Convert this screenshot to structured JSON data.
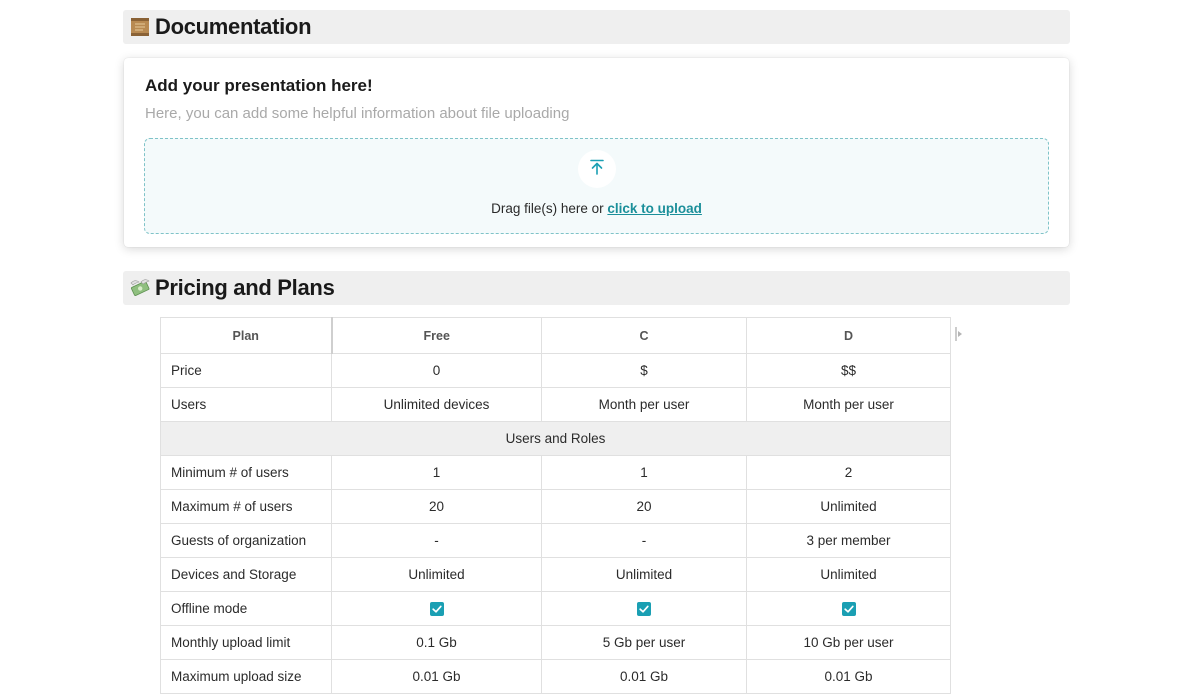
{
  "documentation": {
    "title": "Documentation",
    "icon": "scroll-icon"
  },
  "upload": {
    "title": "Add your presentation here!",
    "subtitle": "Here, you can add some helpful information about file uploading",
    "drop_text": "Drag file(s) here or ",
    "link_text": "click to upload",
    "icon": "upload-arrow-icon"
  },
  "pricing": {
    "title": "Pricing and Plans",
    "icon": "money-wings-icon",
    "headers": [
      "Plan",
      "Free",
      "C",
      "D"
    ],
    "rows": [
      {
        "label": "Price",
        "values": [
          "0",
          "$",
          "$$"
        ]
      },
      {
        "label": "Users",
        "values": [
          "Unlimited devices",
          "Month per user",
          "Month per user"
        ]
      },
      {
        "group": "Users and Roles"
      },
      {
        "label": "Minimum # of users",
        "values": [
          "1",
          "1",
          "2"
        ]
      },
      {
        "label": "Maximum # of users",
        "values": [
          "20",
          "20",
          "Unlimited"
        ]
      },
      {
        "label": "Guests of organization",
        "values": [
          "-",
          "-",
          "3 per member"
        ]
      },
      {
        "label": "Devices and Storage",
        "values": [
          "Unlimited",
          "Unlimited",
          "Unlimited"
        ]
      },
      {
        "label": "Offline mode",
        "checkbox": [
          true,
          true,
          true
        ]
      },
      {
        "label": "Monthly upload limit",
        "values": [
          "0.1 Gb",
          "5 Gb per user",
          "10 Gb per user"
        ]
      },
      {
        "label": "Maximum upload size",
        "values": [
          "0.01 Gb",
          "0.01 Gb",
          "0.01 Gb"
        ]
      }
    ]
  },
  "colors": {
    "accent": "#1a9fb3",
    "link": "#1b8f9a",
    "header_bg": "#efefef"
  }
}
